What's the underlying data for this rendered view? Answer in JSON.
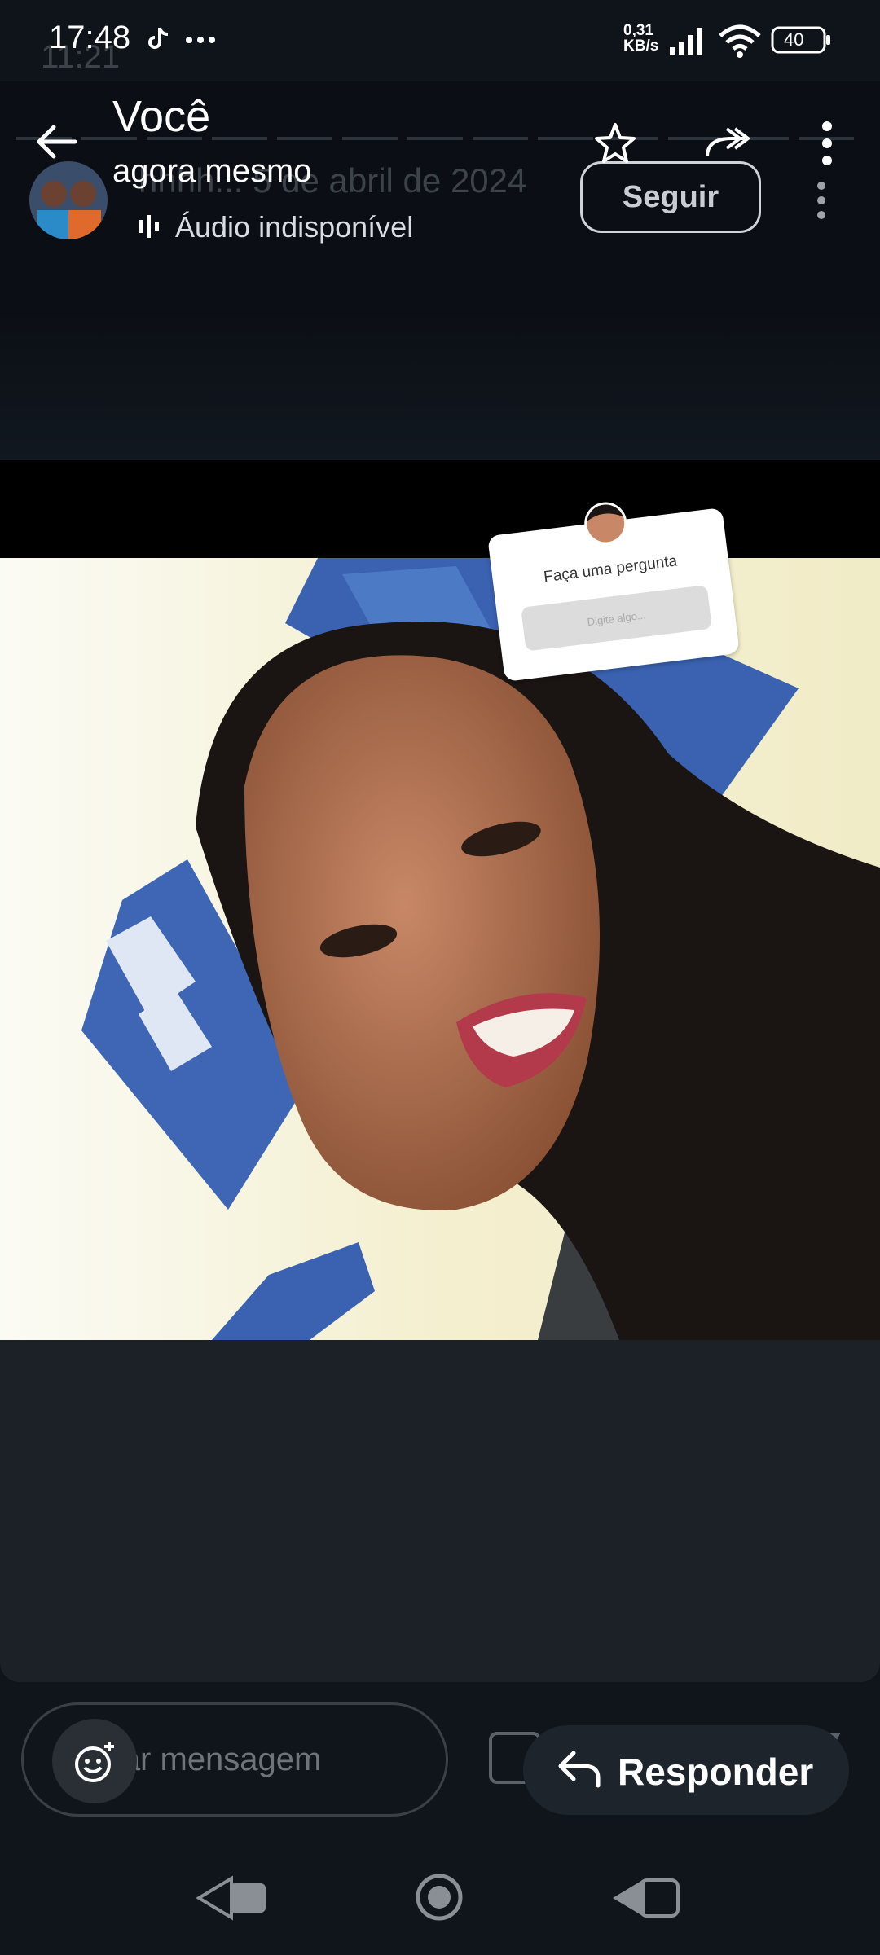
{
  "status_bar": {
    "time": "17:48",
    "ghost_time": "11:21",
    "network_speed_value": "0,31",
    "network_speed_unit": "KB/s",
    "battery": "40"
  },
  "header": {
    "title": "Você",
    "subtitle": "agora mesmo",
    "ghost_date": "hhhh... 5 de abril de 2024",
    "audio_status": "Áudio indisponível",
    "follow_label": "Seguir"
  },
  "sticker": {
    "question": "Faça uma pergunta",
    "input_placeholder": "Digite algo..."
  },
  "composer": {
    "placeholder": "Enviar mensagem",
    "reply_label": "Responder"
  },
  "icons": [
    "tiktok-icon",
    "more-dots-icon",
    "signal-icon",
    "wifi-icon",
    "battery-icon",
    "back-arrow-icon",
    "star-icon",
    "forward-icon",
    "kebab-menu-icon",
    "audio-bars-icon",
    "emoji-icon",
    "reply-arrow-icon",
    "nav-back-icon",
    "nav-home-icon",
    "nav-recents-icon"
  ],
  "colors": {
    "background": "#0f141b",
    "panel": "#1c2127",
    "accent_white": "#ffffff",
    "door_blue": "#3a62b0",
    "wall_yellow": "#f1ecc8"
  }
}
